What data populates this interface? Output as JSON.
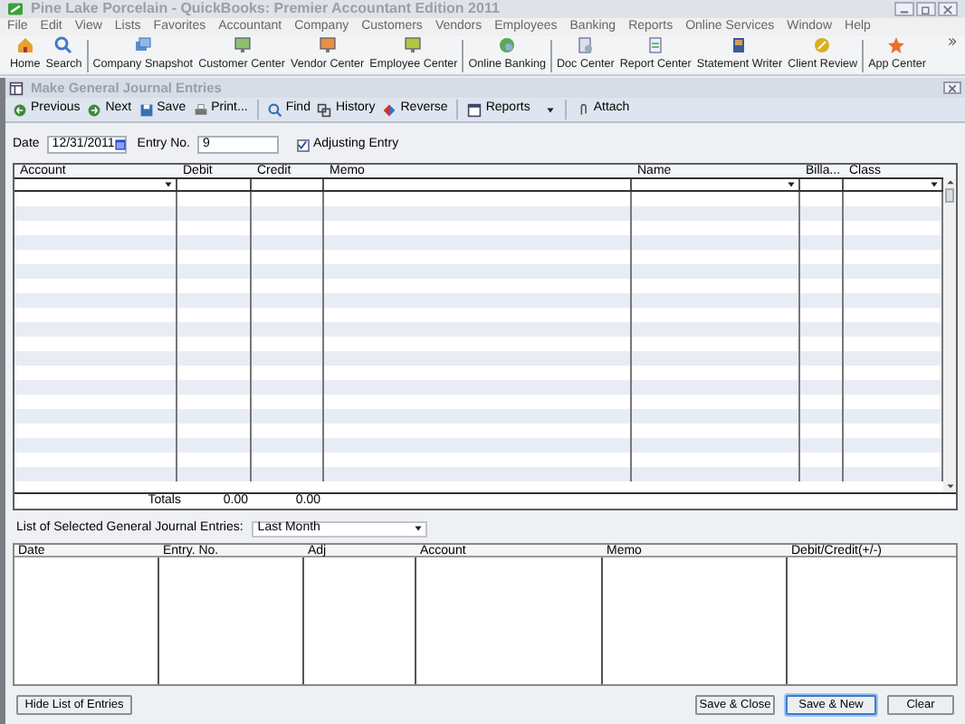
{
  "window": {
    "title": "Pine Lake Porcelain  - QuickBooks: Premier Accountant Edition 2011"
  },
  "menu": [
    "File",
    "Edit",
    "View",
    "Lists",
    "Favorites",
    "Accountant",
    "Company",
    "Customers",
    "Vendors",
    "Employees",
    "Banking",
    "Reports",
    "Online Services",
    "Window",
    "Help"
  ],
  "icon_bar": [
    {
      "label": "Home"
    },
    {
      "label": "Search"
    },
    {
      "label": "Company Snapshot",
      "separator_before": true
    },
    {
      "label": "Customer Center"
    },
    {
      "label": "Vendor Center"
    },
    {
      "label": "Employee Center"
    },
    {
      "label": "Online Banking",
      "separator_before": true
    },
    {
      "label": "Doc Center",
      "separator_before": true
    },
    {
      "label": "Report Center"
    },
    {
      "label": "Statement Writer"
    },
    {
      "label": "Client Review"
    },
    {
      "label": "App Center",
      "separator_before": true
    }
  ],
  "form": {
    "title": "Make General Journal Entries",
    "toolbar": [
      {
        "label": "Previous"
      },
      {
        "label": "Next"
      },
      {
        "label": "Save"
      },
      {
        "label": "Print..."
      },
      {
        "label": "Find",
        "separator_before": true
      },
      {
        "label": "History"
      },
      {
        "label": "Reverse"
      },
      {
        "label": "Reports",
        "separator_before": true,
        "dropdown": true
      },
      {
        "label": "Attach",
        "separator_before": true
      }
    ],
    "date_label": "Date",
    "date": "12/31/2011",
    "entry_no_label": "Entry No.",
    "entry_no": "9",
    "adjusting_entry": {
      "label": "Adjusting Entry",
      "checked": true
    },
    "grid_columns": [
      {
        "label": "Account",
        "dropdown": true
      },
      {
        "label": "Debit"
      },
      {
        "label": "Credit"
      },
      {
        "label": "Memo"
      },
      {
        "label": "Name",
        "dropdown": true
      },
      {
        "label": "Billa..."
      },
      {
        "label": "Class",
        "dropdown": true
      }
    ],
    "totals_label": "Totals",
    "total_debit": "0.00",
    "total_credit": "0.00",
    "list_label": "List of Selected General Journal Entries:",
    "list_filter": "Last Month",
    "list_columns": [
      "Date",
      "Entry. No.",
      "Adj",
      "Account",
      "Memo",
      "Debit/Credit(+/-)"
    ],
    "buttons": [
      {
        "label": "Hide List of Entries",
        "kind": "left"
      },
      {
        "label": "Save & Close",
        "kind": "right"
      },
      {
        "label": "Save & New",
        "kind": "default"
      },
      {
        "label": "Clear",
        "kind": "right"
      }
    ]
  }
}
